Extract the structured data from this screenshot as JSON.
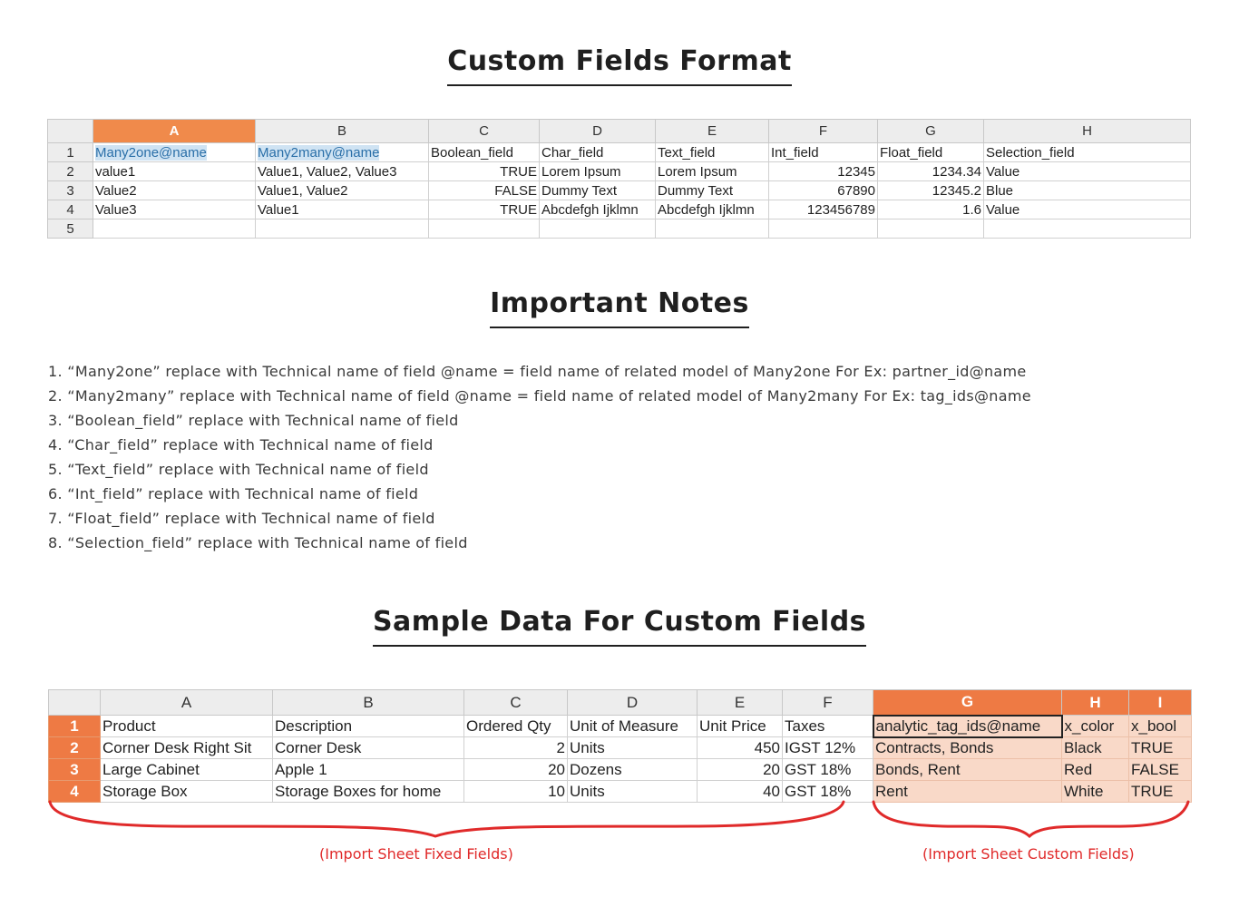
{
  "headings": {
    "format": "Custom Fields Format",
    "notes": "Important Notes",
    "sample": "Sample Data For Custom Fields"
  },
  "sheet1": {
    "columns": [
      "A",
      "B",
      "C",
      "D",
      "E",
      "F",
      "G",
      "H"
    ],
    "row_numbers": [
      "1",
      "2",
      "3",
      "4",
      "5"
    ],
    "rows": [
      [
        "Many2one@name",
        "Many2many@name",
        "Boolean_field",
        "Char_field",
        "Text_field",
        "Int_field",
        "Float_field",
        "Selection_field"
      ],
      [
        "value1",
        "Value1, Value2, Value3",
        "TRUE",
        "Lorem Ipsum",
        "Lorem Ipsum",
        "12345",
        "1234.34",
        "Value"
      ],
      [
        "Value2",
        "Value1, Value2",
        "FALSE",
        "Dummy Text",
        "Dummy Text",
        "67890",
        "12345.2",
        "Blue"
      ],
      [
        "Value3",
        "Value1",
        "TRUE",
        "Abcdefgh Ijklmn",
        "Abcdefgh Ijklmn",
        "123456789",
        "1.6",
        "Value"
      ],
      [
        "",
        "",
        "",
        "",
        "",
        "",
        "",
        ""
      ]
    ]
  },
  "notes": [
    "1. “Many2one”  replace with Technical name of field @name =  field name of related model of Many2one For Ex:   partner_id@name",
    "2. “Many2many”  replace with Technical name of field @name =  field name of related model of Many2many For Ex:   tag_ids@name",
    "3. “Boolean_field”  replace with Technical name of field",
    "4. “Char_field”  replace with Technical name of field",
    "5. “Text_field”  replace with Technical name of field",
    "6. “Int_field”  replace with Technical name of field",
    "7. “Float_field”  replace with Technical name of field",
    "8. “Selection_field”  replace with Technical name of field"
  ],
  "sheet2": {
    "columns": [
      "A",
      "B",
      "C",
      "D",
      "E",
      "F",
      "G",
      "H",
      "I"
    ],
    "row_numbers": [
      "1",
      "2",
      "3",
      "4"
    ],
    "rows": [
      [
        "Product",
        "Description",
        "Ordered Qty",
        "Unit of Measure",
        "Unit Price",
        "Taxes",
        "analytic_tag_ids@name",
        "x_color",
        "x_bool"
      ],
      [
        "Corner Desk Right Sit",
        "Corner Desk",
        "2",
        "Units",
        "450",
        "IGST 12%",
        "Contracts, Bonds",
        "Black",
        "TRUE"
      ],
      [
        "Large Cabinet",
        "Apple 1",
        "20",
        "Dozens",
        "20",
        "GST 18%",
        "Bonds, Rent",
        "Red",
        "FALSE"
      ],
      [
        "Storage Box",
        "Storage Boxes for home",
        "10",
        "Units",
        "40",
        "GST 18%",
        "Rent",
        "White",
        "TRUE"
      ]
    ]
  },
  "annotations": {
    "fixed": "(Import Sheet Fixed Fields)",
    "custom": "(Import Sheet Custom Fields)",
    "color": "#e02a2a"
  }
}
